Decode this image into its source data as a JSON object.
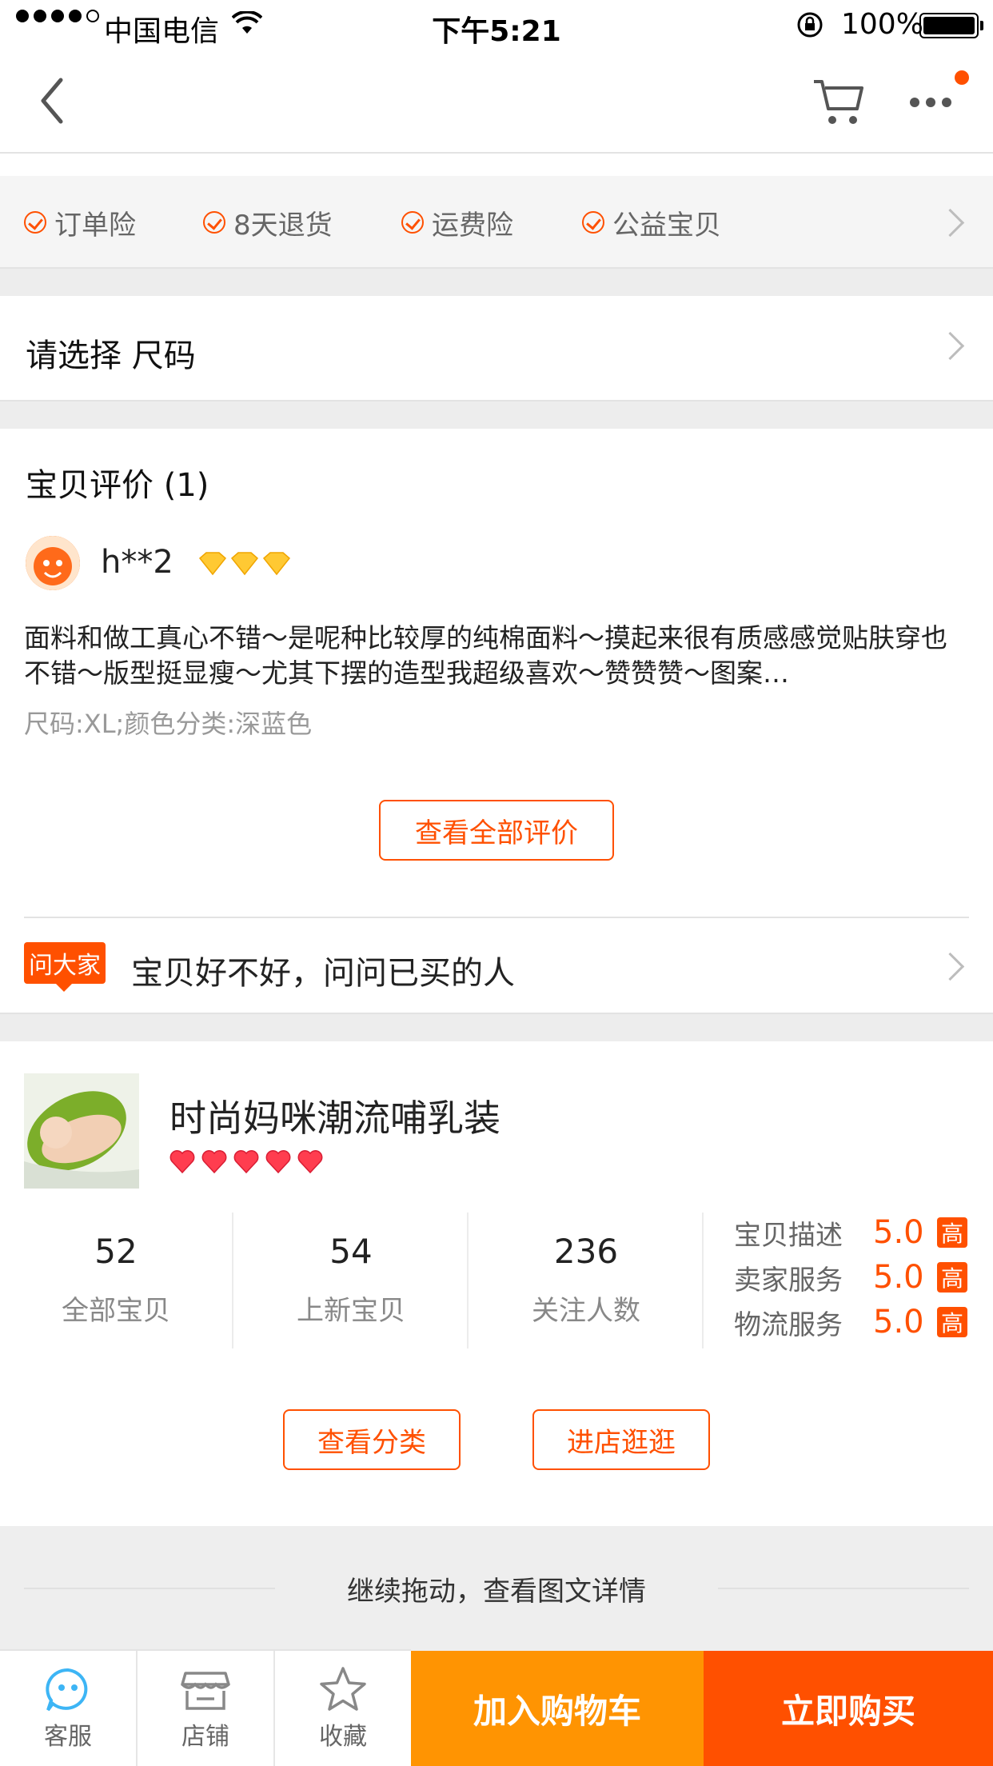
{
  "status_bar": {
    "carrier": "中国电信",
    "time": "下午5:21",
    "battery": "100%",
    "battery_level": 1.0
  },
  "nav": {
    "back_icon": "chevron-left-icon",
    "cart_icon": "cart-icon",
    "more_icon": "more-icon"
  },
  "guarantees": {
    "items": [
      "订单险",
      "8天退货",
      "运费险",
      "公益宝贝"
    ]
  },
  "size_select": {
    "label": "请选择 尺码"
  },
  "reviews": {
    "title": "宝贝评价",
    "count": "(1)",
    "user": "h**2",
    "text": "面料和做工真心不错～是呢种比较厚的纯棉面料～摸起来很有质感感觉贴肤穿也不错～版型挺显瘦～尤其下摆的造型我超级喜欢～赞赞赞～图案…",
    "sku": "尺码:XL;颜色分类:深蓝色",
    "view_all": "查看全部评价"
  },
  "ask": {
    "tag": "问大家",
    "text": "宝贝好不好，问问已买的人"
  },
  "shop": {
    "name": "时尚妈咪潮流哺乳装",
    "hearts": 5,
    "stats": [
      {
        "num": "52",
        "label": "全部宝贝"
      },
      {
        "num": "54",
        "label": "上新宝贝"
      },
      {
        "num": "236",
        "label": "关注人数"
      }
    ],
    "ratings": [
      {
        "label": "宝贝描述",
        "score": "5.0",
        "level": "高"
      },
      {
        "label": "卖家服务",
        "score": "5.0",
        "level": "高"
      },
      {
        "label": "物流服务",
        "score": "5.0",
        "level": "高"
      }
    ],
    "view_category": "查看分类",
    "enter_shop": "进店逛逛"
  },
  "drag_hint": "继续拖动，查看图文详情",
  "bottom_bar": {
    "service": "客服",
    "shop": "店铺",
    "favorite": "收藏",
    "add_cart": "加入购物车",
    "buy_now": "立即购买"
  },
  "colors": {
    "accent": "#ff5000",
    "add_cart_bg": "#ff9402",
    "buy_bg": "#ff5000",
    "service_icon": "#3db5f5"
  }
}
